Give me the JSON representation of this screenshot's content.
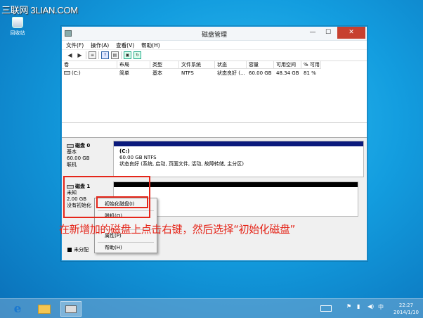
{
  "watermark": "三联网 3LIAN.COM",
  "desktop": {
    "recycle_bin_label": "回收站"
  },
  "window": {
    "title": "磁盘管理",
    "min_symbol": "—",
    "max_symbol": "☐",
    "close_symbol": "✕"
  },
  "menu": [
    "文件(F)",
    "操作(A)",
    "查看(V)",
    "帮助(H)"
  ],
  "volume_table": {
    "headers": [
      "卷",
      "布局",
      "类型",
      "文件系统",
      "状态",
      "容量",
      "可用空间",
      "% 可用"
    ],
    "rows": [
      [
        "(C:)",
        "简单",
        "基本",
        "NTFS",
        "状态良好 (...",
        "60.00 GB",
        "48.34 GB",
        "81 %"
      ]
    ]
  },
  "disks": [
    {
      "name": "磁盘 0",
      "type": "基本",
      "size": "60.00 GB",
      "status": "联机",
      "partition": {
        "name": "(C:)",
        "detail": "60.00 GB NTFS",
        "status": "状态良好 (系统, 启动, 页面文件, 活动, 故障转储, 主分区)"
      }
    },
    {
      "name": "磁盘 1",
      "type": "未知",
      "size": "2.00 GB",
      "status": "没有初始化"
    }
  ],
  "legend": "未分配",
  "context_menu": {
    "items": [
      "初始化磁盘(I)",
      "脱机(O)",
      "属性(P)",
      "帮助(H)"
    ],
    "highlighted": "初始化磁盘(I)"
  },
  "annotation": "在新增加的磁盘上点击右键，然后选择“初始化磁盘”",
  "taskbar": {
    "clock_time": "22:27",
    "clock_date": "2014/1/10",
    "tray_lang": "中"
  },
  "colors": {
    "desktop": "#139ddf",
    "primary_partition": "#0b1a7c",
    "annotation_red": "#e5261a",
    "close_button": "#c7402f"
  }
}
